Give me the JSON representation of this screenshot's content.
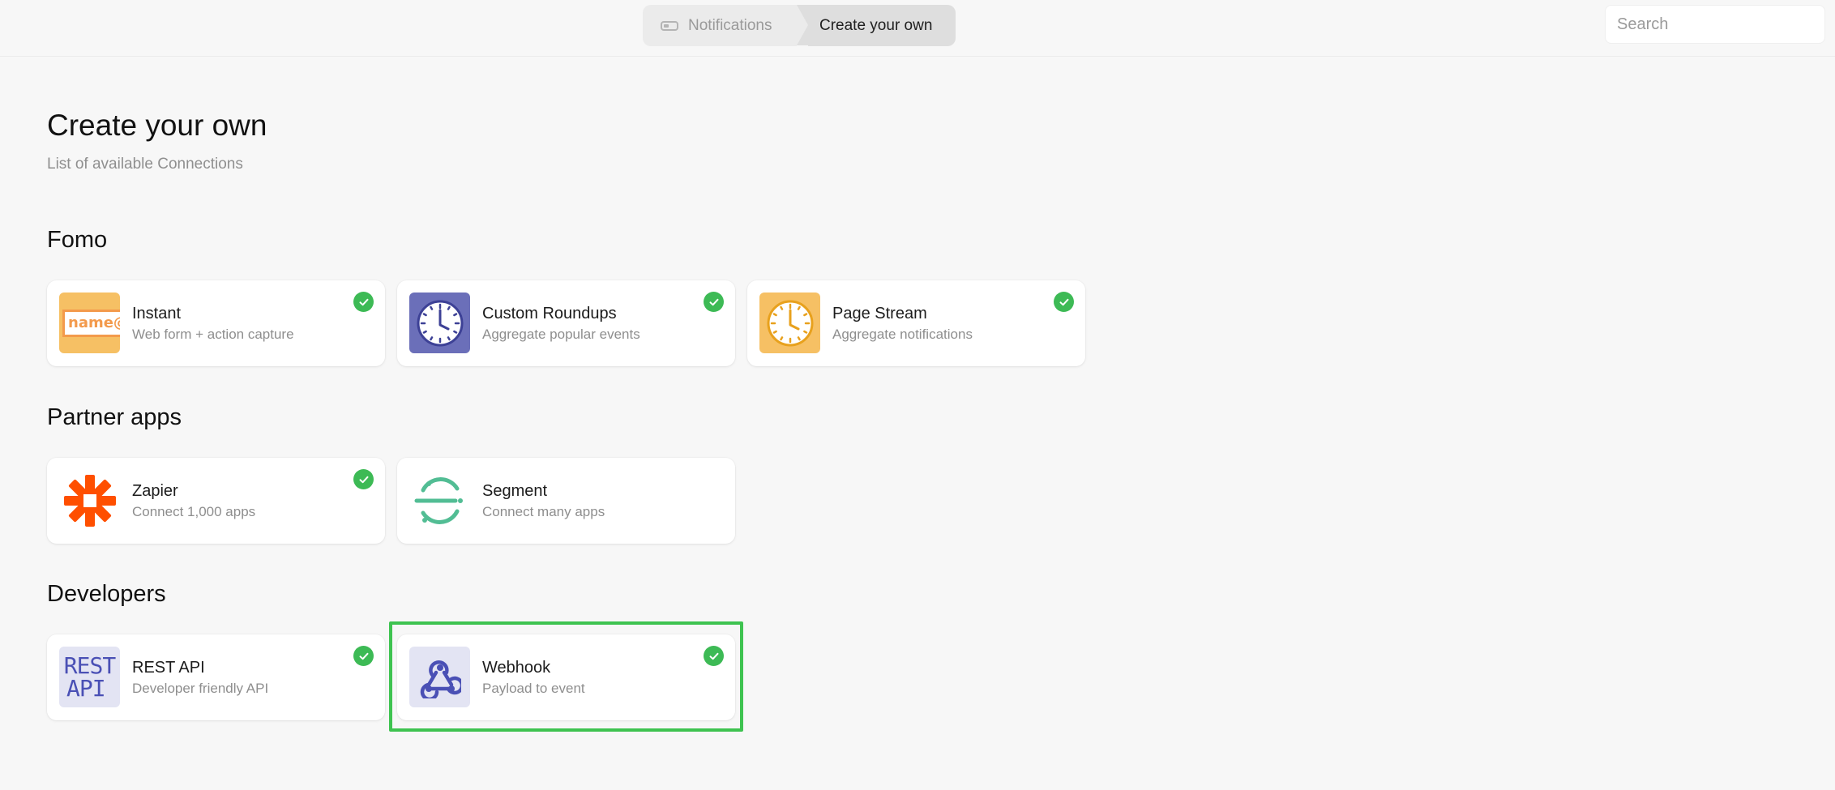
{
  "breadcrumb": {
    "first_label": "Notifications",
    "second_label": "Create your own"
  },
  "search": {
    "placeholder": "Search",
    "value": ""
  },
  "page": {
    "title": "Create your own",
    "subtitle": "List of available Connections"
  },
  "sections": {
    "fomo": "Fomo",
    "partner": "Partner apps",
    "developers": "Developers"
  },
  "cards": {
    "instant": {
      "name": "Instant",
      "desc": "Web form + action capture",
      "logo_text": "name@",
      "connected": true
    },
    "roundups": {
      "name": "Custom Roundups",
      "desc": "Aggregate popular events",
      "connected": true
    },
    "pagestream": {
      "name": "Page Stream",
      "desc": "Aggregate notifications",
      "connected": true
    },
    "zapier": {
      "name": "Zapier",
      "desc": "Connect 1,000 apps",
      "connected": true
    },
    "segment": {
      "name": "Segment",
      "desc": "Connect many apps",
      "connected": false
    },
    "restapi": {
      "name": "REST API",
      "desc": "Developer friendly API",
      "logo_line1": "REST",
      "logo_line2": "API",
      "connected": true
    },
    "webhook": {
      "name": "Webhook",
      "desc": "Payload to event",
      "connected": true,
      "highlighted": true
    }
  },
  "colors": {
    "check": "#3dba55",
    "highlight": "#3ec350",
    "fomo_orange": "#f6c064",
    "roundups_purple": "#6b6fb9",
    "zapier_orange": "#ff4f00",
    "segment_green": "#52bd94",
    "dev_logo_bg": "#e3e4f3",
    "dev_logo_fg": "#4a50b5"
  },
  "icons": {
    "breadcrumb_first": "toggle-icon",
    "check": "check-circle-icon",
    "roundups": "clock-icon",
    "pagestream": "clock-icon",
    "zapier": "zapier-asterisk-icon",
    "segment": "segment-logo-icon",
    "webhook": "webhook-icon"
  }
}
